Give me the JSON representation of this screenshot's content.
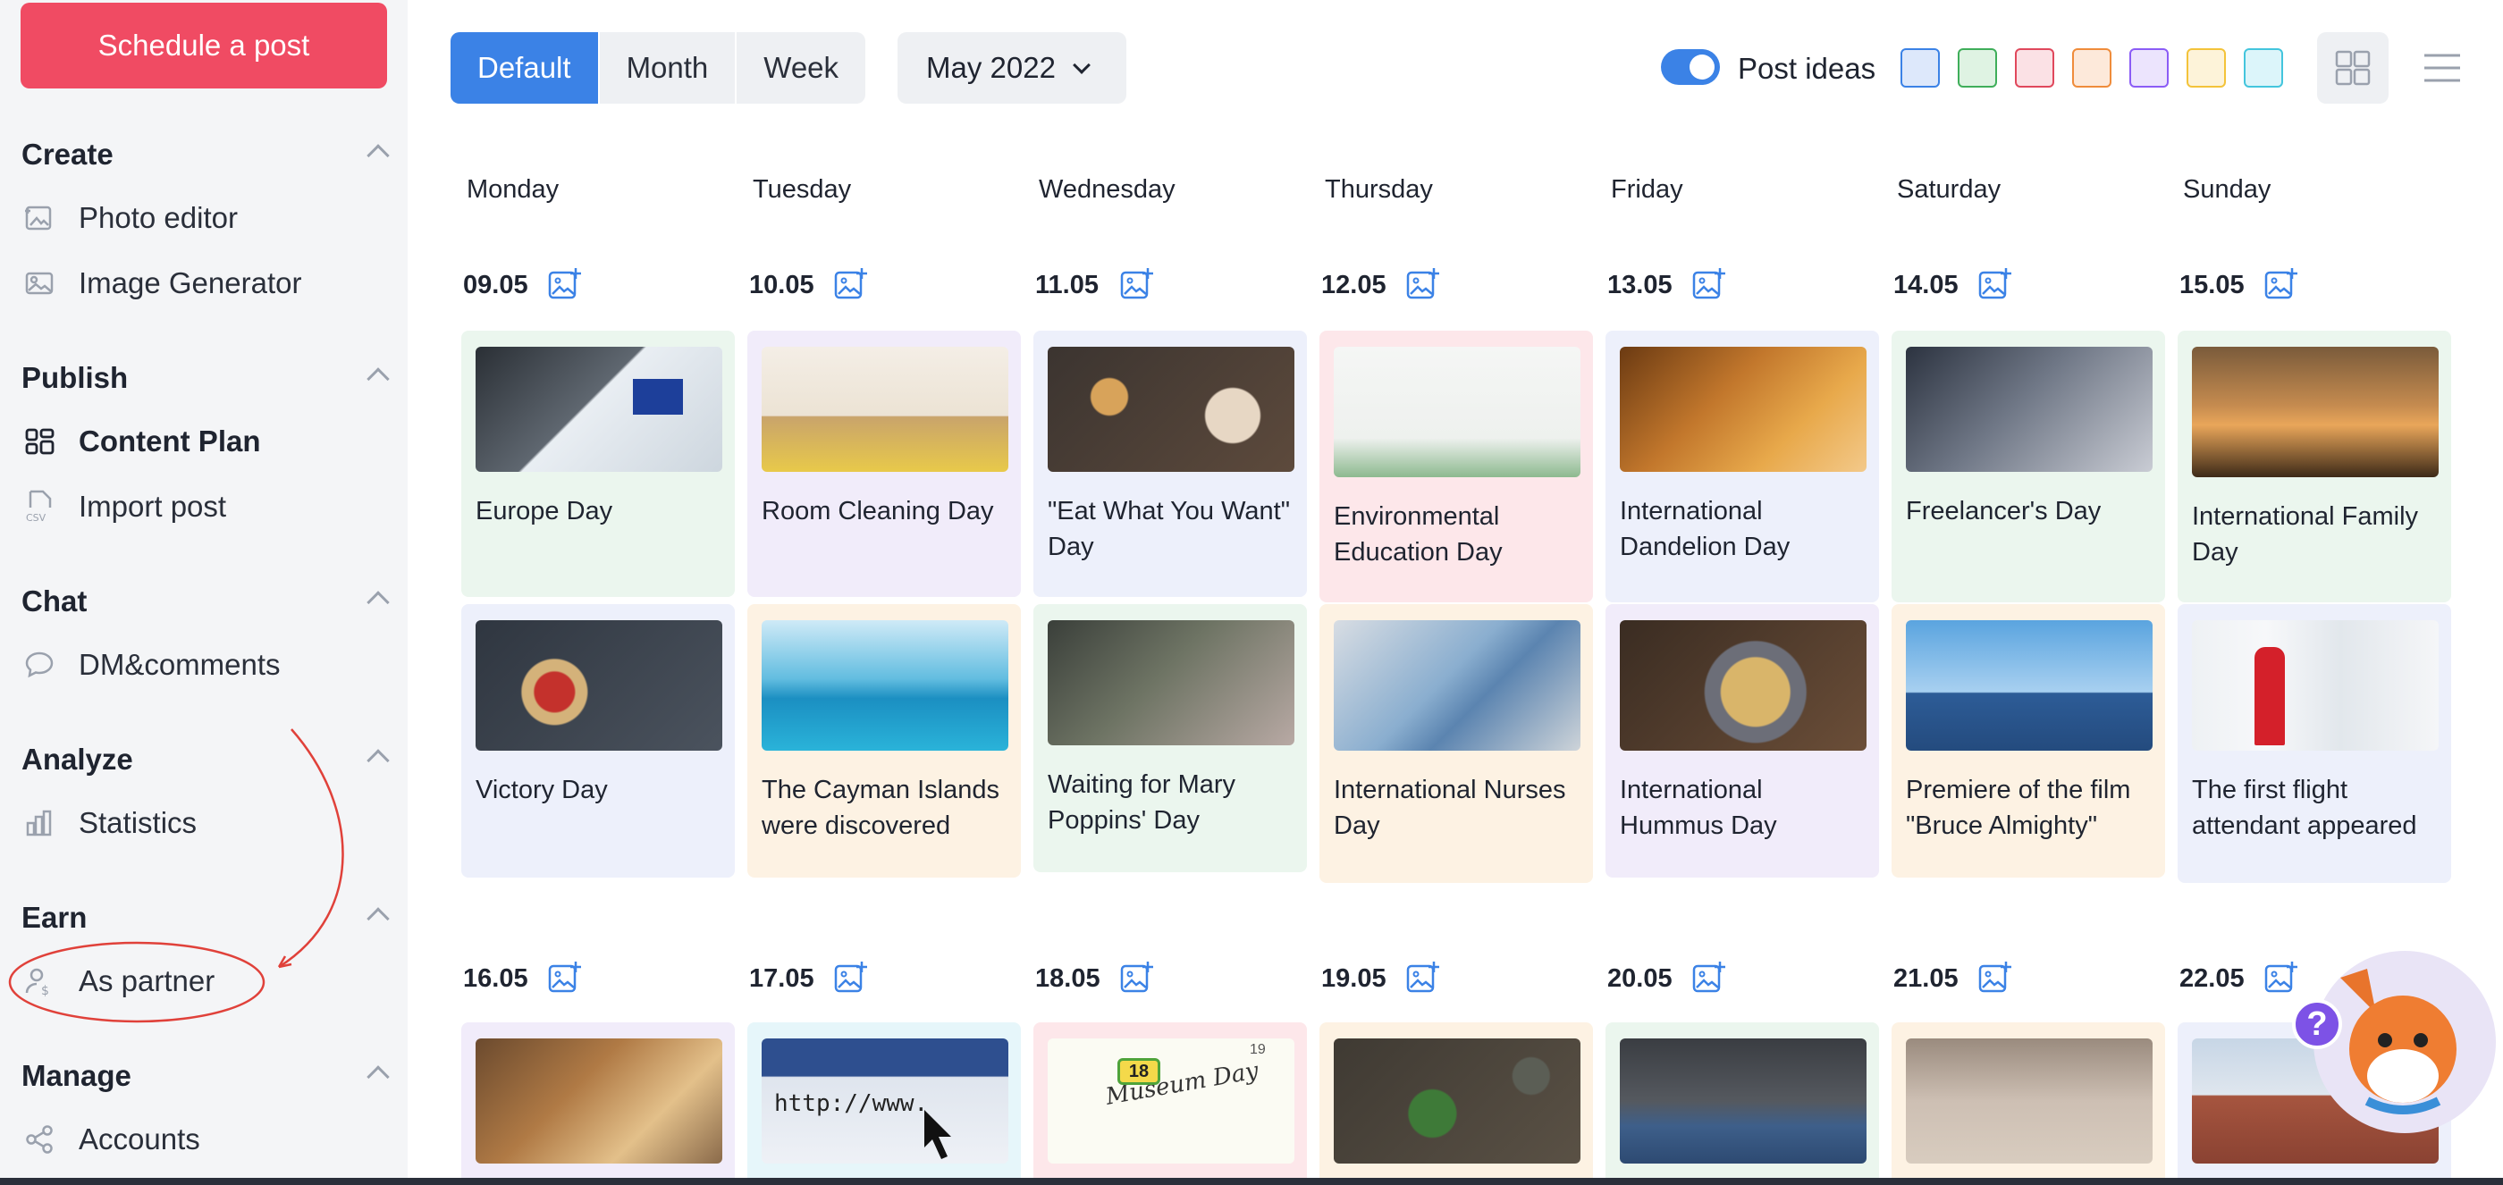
{
  "sidebar": {
    "cta_label": "Schedule a post",
    "sections": [
      {
        "title": "Create",
        "items": [
          {
            "label": "Photo editor",
            "icon": "photo-editor-icon"
          },
          {
            "label": "Image Generator",
            "icon": "image-icon"
          }
        ]
      },
      {
        "title": "Publish",
        "items": [
          {
            "label": "Content Plan",
            "icon": "grid-icon",
            "active": true
          },
          {
            "label": "Import post",
            "icon": "csv-icon"
          }
        ]
      },
      {
        "title": "Chat",
        "items": [
          {
            "label": "DM&comments",
            "icon": "chat-icon"
          }
        ]
      },
      {
        "title": "Analyze",
        "items": [
          {
            "label": "Statistics",
            "icon": "bar-chart-icon"
          }
        ]
      },
      {
        "title": "Earn",
        "items": [
          {
            "label": "As partner",
            "icon": "partner-icon"
          }
        ]
      },
      {
        "title": "Manage",
        "items": [
          {
            "label": "Accounts",
            "icon": "share-icon"
          }
        ]
      }
    ]
  },
  "toolbar": {
    "view_tabs": [
      "Default",
      "Month",
      "Week"
    ],
    "active_tab": "Default",
    "month": "May 2022",
    "post_ideas_label": "Post ideas",
    "post_ideas_on": true,
    "color_filters": [
      "#3b82e6",
      "#3fae5a",
      "#e0485c",
      "#ef8c3b",
      "#8b5cf6",
      "#f3c33a",
      "#43c5dd"
    ]
  },
  "calendar": {
    "days": [
      "Monday",
      "Tuesday",
      "Wednesday",
      "Thursday",
      "Friday",
      "Saturday",
      "Sunday"
    ],
    "weeks": [
      {
        "dates": [
          "09.05",
          "10.05",
          "11.05",
          "12.05",
          "13.05",
          "14.05",
          "15.05"
        ],
        "row1": [
          "Europe Day",
          "Room Cleaning Day",
          "\"Eat What You Want\" Day",
          "Environmental Education Day",
          "International Dandelion Day",
          "Freelancer's Day",
          "International Family Day"
        ],
        "row2": [
          "Victory Day",
          "The Cayman Islands were discovered",
          "Waiting for Mary Poppins' Day",
          "International Nurses Day",
          "International Hummus Day",
          "Premiere of the film \"Bruce Almighty\"",
          "The first flight attendant appeared"
        ]
      },
      {
        "dates": [
          "16.05",
          "17.05",
          "18.05",
          "19.05",
          "20.05",
          "21.05",
          "22.05"
        ]
      }
    ],
    "image_texts": {
      "url": "http://www.",
      "museum": "Museum Day",
      "cal_number": "18",
      "cal_corner": "19"
    }
  },
  "help_label": "?"
}
